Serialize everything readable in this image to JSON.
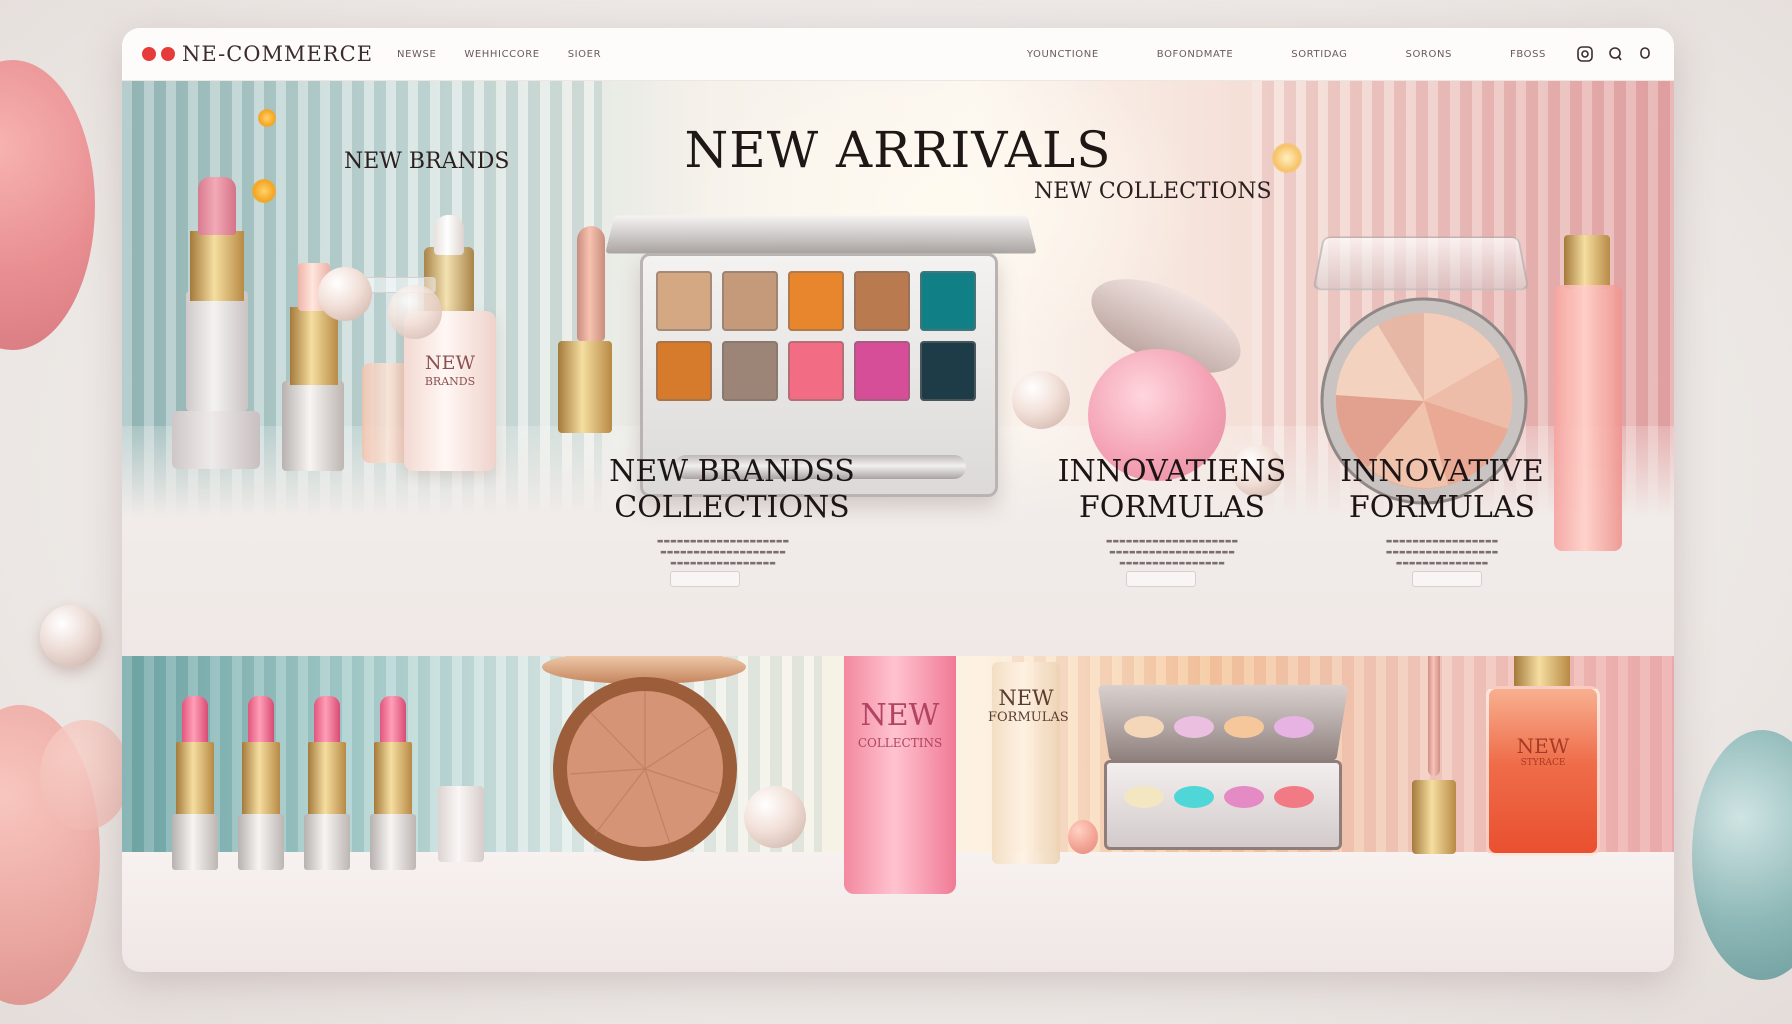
{
  "topbar": {
    "brand": "NE-COMMERCE",
    "nav_left": [
      "NEWSE",
      "WEHHICCORE",
      "SIOER"
    ],
    "nav_right": [
      "YOUNCTIONE",
      "BOFONDMATE",
      "SORTIDAG",
      "SORONS",
      "FBOSS"
    ],
    "icons": [
      "search-icon",
      "user-icon",
      "bag-icon"
    ]
  },
  "hero": {
    "title": "NEW ARRIVALS",
    "left_heading": "NEW BRANDS",
    "right_heading": "NEW COLLECTIONS",
    "features": [
      {
        "line1": "NEW BRANDSS",
        "line2": "COLLECTIONS"
      },
      {
        "line1": "INNOVATIENS",
        "line2": "FORMULAS"
      },
      {
        "line1": "INNOVATIVE",
        "line2": "FORMULAS"
      }
    ],
    "serum_label": {
      "line1": "NEW",
      "line2": "BRANDS"
    }
  },
  "bottom": {
    "bottle_label": {
      "line1": "NEW",
      "line2": "COLLECTINS"
    },
    "tube_label": {
      "line1": "NEW",
      "line2": "FORMULAS"
    },
    "perfume_label": {
      "line1": "NEW",
      "line2": "STYRACE"
    }
  },
  "colors": {
    "accent_dot": "#e53b3b",
    "text_dark": "#1f1616",
    "pink": "#f291a6",
    "teal": "#6fa5a6"
  },
  "palette_swatches_top": [
    "#d3a883",
    "#c59a7a",
    "#e8862e",
    "#b97a4f",
    "#117f86"
  ],
  "palette_swatches_bottom": [
    "#d67a2c",
    "#9c8576",
    "#f26c84",
    "#d64d98",
    "#1d3c47"
  ],
  "mini_palette_top": [
    "#f4d6b8",
    "#eabfe0",
    "#f7c79c",
    "#e7b3e3"
  ],
  "mini_palette_bottom": [
    "#f3e7c1",
    "#4fd6d6",
    "#e48ac5",
    "#f17a84"
  ]
}
